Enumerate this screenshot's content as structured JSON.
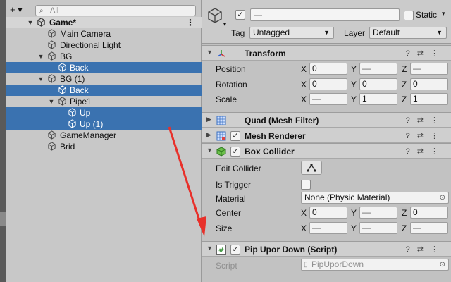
{
  "hierarchy": {
    "search_placeholder": "All",
    "add_label": "+ ▾",
    "items": [
      {
        "label": "Game*"
      },
      {
        "label": "Main Camera"
      },
      {
        "label": "Directional Light"
      },
      {
        "label": "BG"
      },
      {
        "label": "Back"
      },
      {
        "label": "BG (1)"
      },
      {
        "label": "Back"
      },
      {
        "label": "Pipe1"
      },
      {
        "label": "Up"
      },
      {
        "label": "Up (1)"
      },
      {
        "label": "GameManager"
      },
      {
        "label": "Brid"
      }
    ]
  },
  "inspector": {
    "name_value": "—",
    "static_label": "Static",
    "tag_label": "Tag",
    "tag_value": "Untagged",
    "layer_label": "Layer",
    "layer_value": "Default",
    "transform": {
      "title": "Transform",
      "position_label": "Position",
      "rotation_label": "Rotation",
      "scale_label": "Scale",
      "axes": [
        "X",
        "Y",
        "Z"
      ],
      "position": [
        "0",
        "—",
        "—"
      ],
      "rotation": [
        "0",
        "0",
        "0"
      ],
      "scale": [
        "—",
        "1",
        "1"
      ]
    },
    "mesh_filter_title": "Quad (Mesh Filter)",
    "mesh_renderer_title": "Mesh Renderer",
    "box_collider": {
      "title": "Box Collider",
      "edit_collider_label": "Edit Collider",
      "is_trigger_label": "Is Trigger",
      "material_label": "Material",
      "material_value": "None (Physic Material)",
      "center_label": "Center",
      "size_label": "Size",
      "center": [
        "0",
        "—",
        "0"
      ],
      "size": [
        "—",
        "—",
        "—"
      ]
    },
    "script_component": {
      "title": "Pip Upor Down (Script)",
      "script_label": "Script",
      "script_value": "PipUporDown"
    }
  },
  "colors": {
    "selection": "#3a72b0",
    "annotation_arrow": "#e8302a"
  }
}
